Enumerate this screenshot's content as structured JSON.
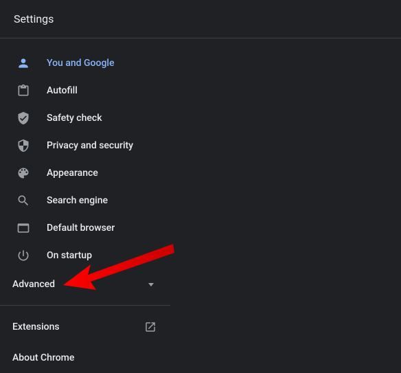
{
  "header": {
    "title": "Settings"
  },
  "sidebar": {
    "items": [
      {
        "label": "You and Google"
      },
      {
        "label": "Autofill"
      },
      {
        "label": "Safety check"
      },
      {
        "label": "Privacy and security"
      },
      {
        "label": "Appearance"
      },
      {
        "label": "Search engine"
      },
      {
        "label": "Default browser"
      },
      {
        "label": "On startup"
      }
    ],
    "advanced_label": "Advanced",
    "extensions_label": "Extensions",
    "about_label": "About Chrome"
  }
}
